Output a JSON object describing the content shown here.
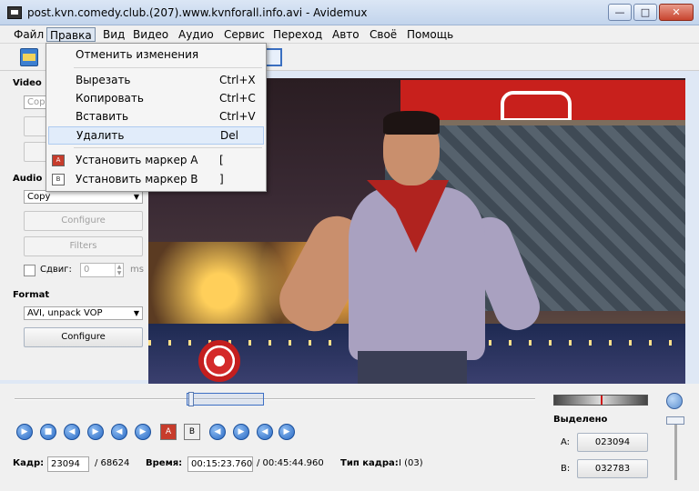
{
  "window": {
    "title": "post.kvn.comedy.club.(207).www.kvnforall.info.avi - Avidemux",
    "minimize": "—",
    "maximize": "□",
    "close": "✕"
  },
  "menubar": [
    "Файл",
    "Правка",
    "Вид",
    "Видео",
    "Аудио",
    "Сервис",
    "Переход",
    "Авто",
    "Своё",
    "Помощь"
  ],
  "edit_menu": {
    "items": [
      {
        "label": "Отменить изменения",
        "shortcut": ""
      },
      {
        "label": "Вырезать",
        "shortcut": "Ctrl+X"
      },
      {
        "label": "Копировать",
        "shortcut": "Ctrl+C"
      },
      {
        "label": "Вставить",
        "shortcut": "Ctrl+V"
      },
      {
        "label": "Удалить",
        "shortcut": "Del"
      },
      {
        "label": "Установить маркер A",
        "shortcut": "["
      },
      {
        "label": "Установить маркер B",
        "shortcut": "]"
      }
    ],
    "icon_a": "A",
    "icon_b": "B"
  },
  "left_panel": {
    "video_label": "Video",
    "video_codec": "Copy",
    "audio_label": "Audio",
    "audio_codec": "Copy",
    "configure": "Configure",
    "filters": "Filters",
    "shift_label": "Сдвиг:",
    "shift_value": "0",
    "shift_unit": "ms",
    "format_label": "Format",
    "format_value": "AVI, unpack VOP",
    "format_configure": "Configure"
  },
  "nav": {
    "marker_a": "A",
    "marker_b": "B"
  },
  "status": {
    "frame_label": "Кадр:",
    "frame_value": "23094",
    "frame_total": "/ 68624",
    "time_label": "Время:",
    "time_value": "00:15:23.760",
    "time_total": "/ 00:45:44.960",
    "frame_type_label": "Тип кадра:",
    "frame_type_value": "I (03)"
  },
  "selection": {
    "label": "Выделено",
    "a_label": "A:",
    "a_value": "023094",
    "b_label": "B:",
    "b_value": "032783"
  },
  "colors": {
    "accent": "#2869c4",
    "marker": "#c73c2c",
    "window_bg": "#f0f0f0"
  }
}
